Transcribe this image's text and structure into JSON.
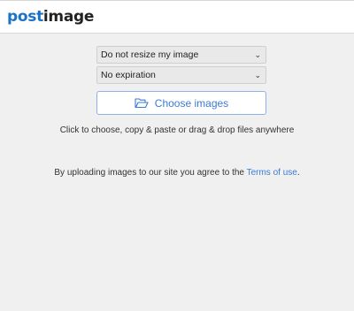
{
  "header": {
    "logo_part1": "post",
    "logo_part2": "image"
  },
  "form": {
    "resize_select": {
      "value": "Do not resize my image",
      "icon": "chevron-down-icon"
    },
    "expiration_select": {
      "value": "No expiration",
      "icon": "chevron-down-icon"
    },
    "choose_button": {
      "label": "Choose images",
      "icon": "folder-open-icon"
    }
  },
  "hint_text": "Click to choose, copy & paste or drag & drop files anywhere",
  "terms": {
    "prefix": "By uploading images to our site you agree to the ",
    "link": "Terms of use",
    "suffix": "."
  },
  "colors": {
    "brand_blue": "#1a73c8",
    "link_blue": "#3a7bd5",
    "background": "#f0f0f0"
  }
}
